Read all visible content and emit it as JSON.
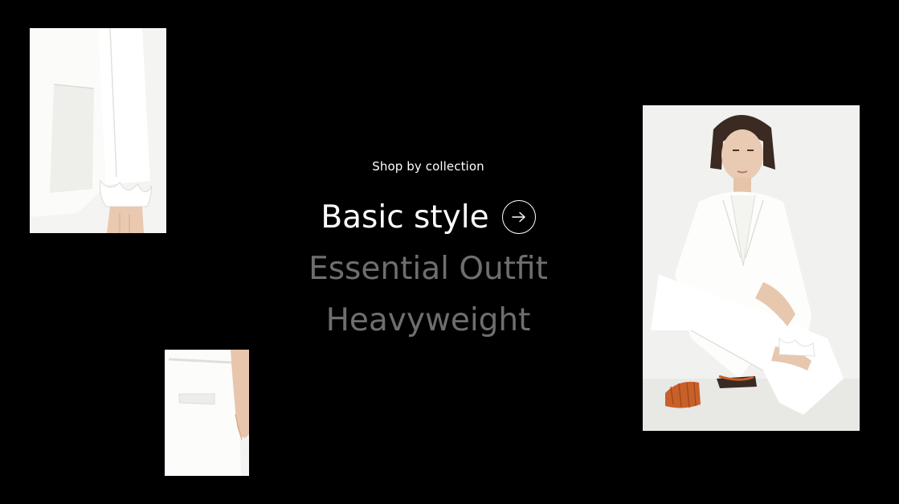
{
  "collection_menu": {
    "eyebrow": "Shop by collection",
    "items": [
      {
        "label": "Basic style",
        "state": "active"
      },
      {
        "label": "Essential Outfit",
        "state": "inactive"
      },
      {
        "label": "Heavyweight",
        "state": "inactive"
      }
    ],
    "arrow_icon": "arrow-right-circle-icon"
  },
  "photos": [
    {
      "name": "sleeve-ruffle-cuff-photo",
      "subject": "white blazer sleeve with ruffled cuff"
    },
    {
      "name": "pants-back-pocket-photo",
      "subject": "white trousers back pocket"
    },
    {
      "name": "model-white-suit-photo",
      "subject": "seated model in white suit with orange woven shoes"
    }
  ],
  "colors": {
    "background": "#000000",
    "active_text": "#ffffff",
    "inactive_text": "#6e6e6e",
    "shoe_accent": "#c8602a"
  }
}
